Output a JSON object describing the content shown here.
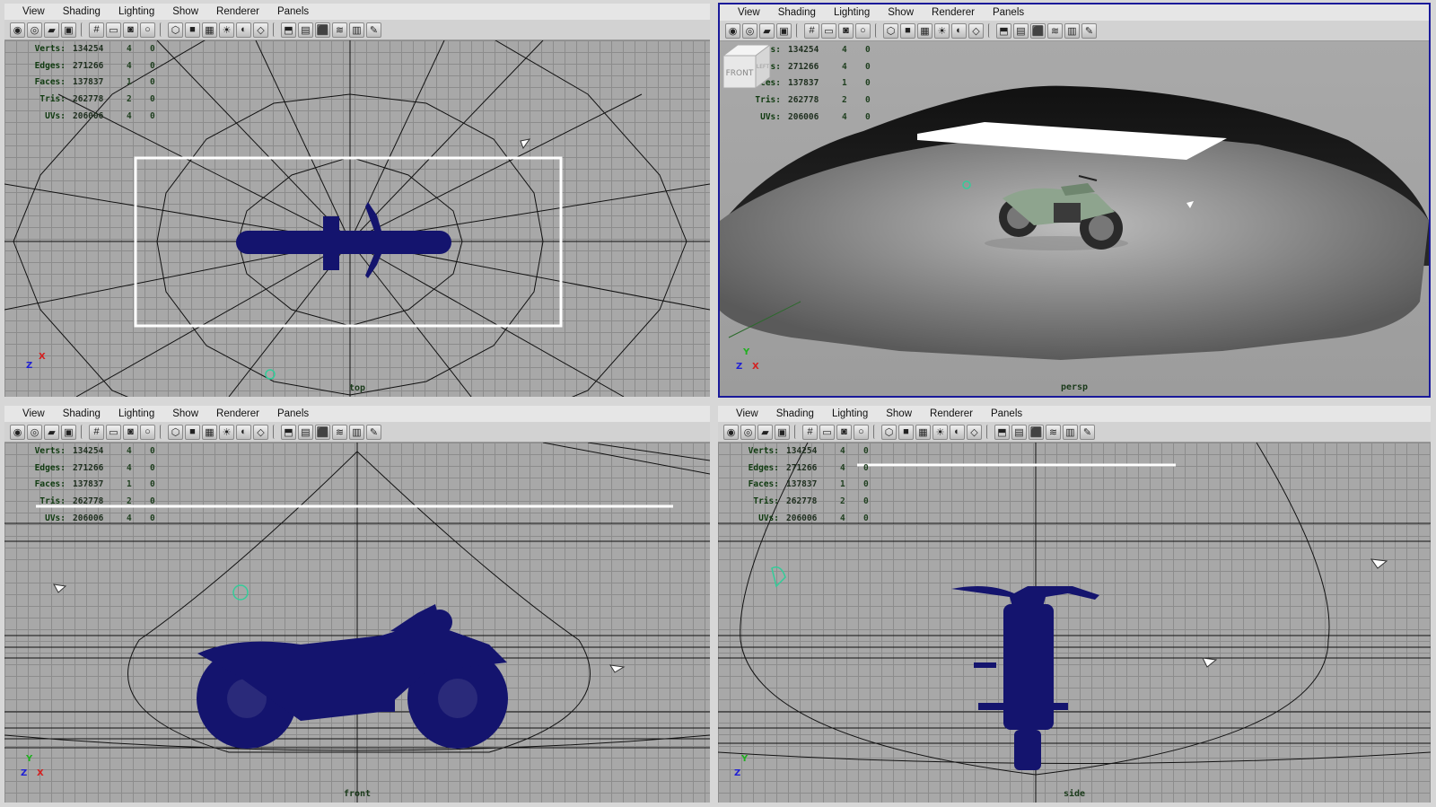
{
  "menu": [
    "View",
    "Shading",
    "Lighting",
    "Show",
    "Renderer",
    "Panels"
  ],
  "toolbar_icons": [
    "camera-icon",
    "camera-attr-icon",
    "bookmark-icon",
    "image-plane-icon",
    "grid-icon",
    "film-gate-icon",
    "resolution-gate-icon",
    "safe-action-icon",
    "wireframe-icon",
    "smooth-shade-icon",
    "textured-icon",
    "use-lights-icon",
    "shadows-icon",
    "xray-icon",
    "isolate-icon",
    "field-chart-icon",
    "ao-icon",
    "motion-blur-icon",
    "aa-icon",
    "hud-icon"
  ],
  "hud_labels": [
    "Verts:",
    "Edges:",
    "Faces:",
    "Tris:",
    "UVs:"
  ],
  "panels": {
    "top": {
      "camera": "top",
      "hud": [
        [
          "134254",
          "4",
          "0"
        ],
        [
          "271266",
          "4",
          "0"
        ],
        [
          "137837",
          "1",
          "0"
        ],
        [
          "262778",
          "2",
          "0"
        ],
        [
          "206006",
          "4",
          "0"
        ]
      ],
      "axis": {
        "up": "Z",
        "right": "X"
      }
    },
    "persp": {
      "camera": "persp",
      "hud": [
        [
          "134254",
          "4",
          "0"
        ],
        [
          "271266",
          "4",
          "0"
        ],
        [
          "137837",
          "1",
          "0"
        ],
        [
          "262778",
          "2",
          "0"
        ],
        [
          "206006",
          "4",
          "0"
        ]
      ],
      "axis": {
        "up": "Y",
        "right": "X",
        "front": "Z"
      },
      "viewcube_front": "FRONT",
      "viewcube_side": "LEFT"
    },
    "front": {
      "camera": "front",
      "hud": [
        [
          "134254",
          "4",
          "0"
        ],
        [
          "271266",
          "4",
          "0"
        ],
        [
          "137837",
          "1",
          "0"
        ],
        [
          "262778",
          "2",
          "0"
        ],
        [
          "206006",
          "4",
          "0"
        ]
      ],
      "axis": {
        "up": "Y",
        "right": "X",
        "front": "Z"
      }
    },
    "side": {
      "camera": "side",
      "hud": [
        [
          "134254",
          "4",
          "0"
        ],
        [
          "271266",
          "4",
          "0"
        ],
        [
          "137837",
          "1",
          "0"
        ],
        [
          "262778",
          "2",
          "0"
        ],
        [
          "206006",
          "4",
          "0"
        ]
      ],
      "axis": {
        "up": "Y",
        "right": "Z"
      }
    }
  },
  "colors": {
    "wire": "#14146e",
    "axis_x": "#d42020",
    "axis_y": "#20b020",
    "axis_z": "#2020d4",
    "active_border": "#1a1a9a"
  }
}
